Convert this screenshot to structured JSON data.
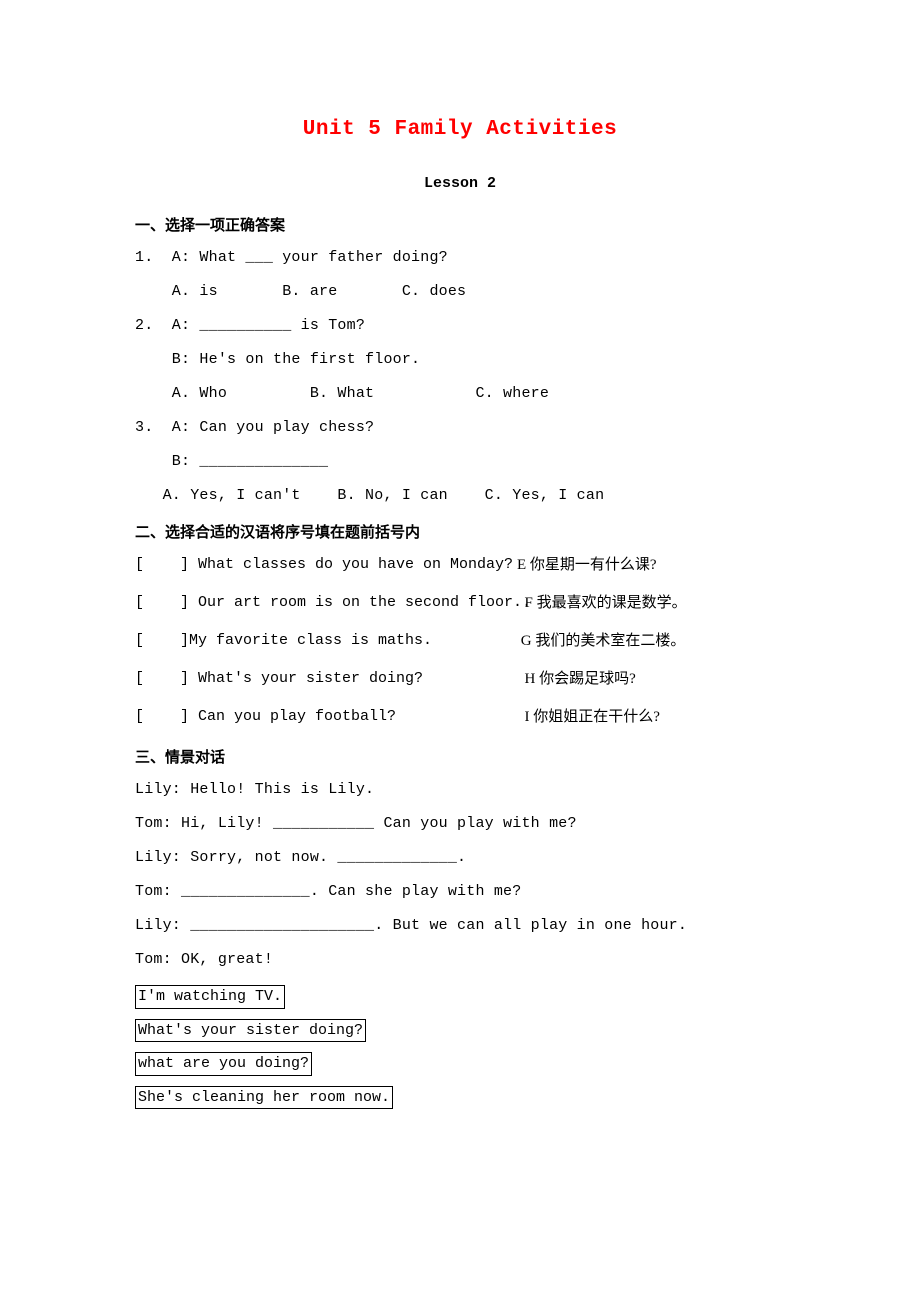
{
  "title": "Unit 5 Family Activities",
  "subtitle": "Lesson 2",
  "section1": {
    "heading": "一、选择一项正确答案",
    "q1_prompt": "1.  A: What ___ your father doing?",
    "q1_choices": "    A. is       B. are       C. does",
    "q2_prompt": "2.  A: __________ is Tom?",
    "q2_context": "    B: He's on the first floor.",
    "q2_choices": "    A. Who         B. What           C. where",
    "q3_prompt": "3.  A: Can you play chess?",
    "q3_context": "    B: ______________",
    "q3_choices": "   A. Yes, I can't    B. No, I can    C. Yes, I can"
  },
  "section2": {
    "heading": "二、选择合适的汉语将序号填在题前括号内",
    "rows": [
      {
        "left": "[    ] What classes do you have on Monday?",
        "right": "E 你星期一有什么课?"
      },
      {
        "left": "[    ] Our art room is on the second floor..",
        "right": "  F 我最喜欢的课是数学。"
      },
      {
        "left": "[    ]My favorite class is maths.",
        "right": " G 我们的美术室在二楼。"
      },
      {
        "left": "[    ] What's your sister doing?",
        "right": "  H 你会踢足球吗?"
      },
      {
        "left": "[    ] Can you play football?",
        "right": "  I 你姐姐正在干什么?"
      }
    ]
  },
  "section3": {
    "heading": "三、情景对话",
    "lines": [
      "Lily: Hello! This is Lily.",
      "Tom: Hi, Lily! ___________ Can you play with me?",
      "Lily: Sorry, not now. _____________.",
      "Tom: ______________. Can she play with me?",
      "Lily: ____________________. But we can all play in one hour.",
      "Tom: OK, great!"
    ],
    "bank": [
      "I'm watching TV.",
      "What's your sister doing?",
      "what are you doing?",
      "She's cleaning her room now."
    ]
  }
}
